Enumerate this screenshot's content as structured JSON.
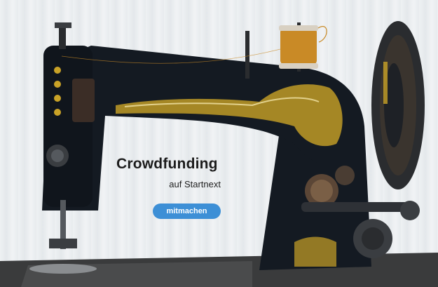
{
  "hero": {
    "title": "Crowdfunding",
    "subtitle": "auf Startnext",
    "cta_label": "mitmachen",
    "image": "vintage-sewing-machine"
  },
  "colors": {
    "cta_background": "#3d8fd6",
    "cta_text": "#ffffff",
    "title_text": "#1c1c1c",
    "machine_body": "#141a22",
    "gold_decor": "#c9a227",
    "thread_spool": "#c98a26",
    "background": "#e9ecef"
  }
}
